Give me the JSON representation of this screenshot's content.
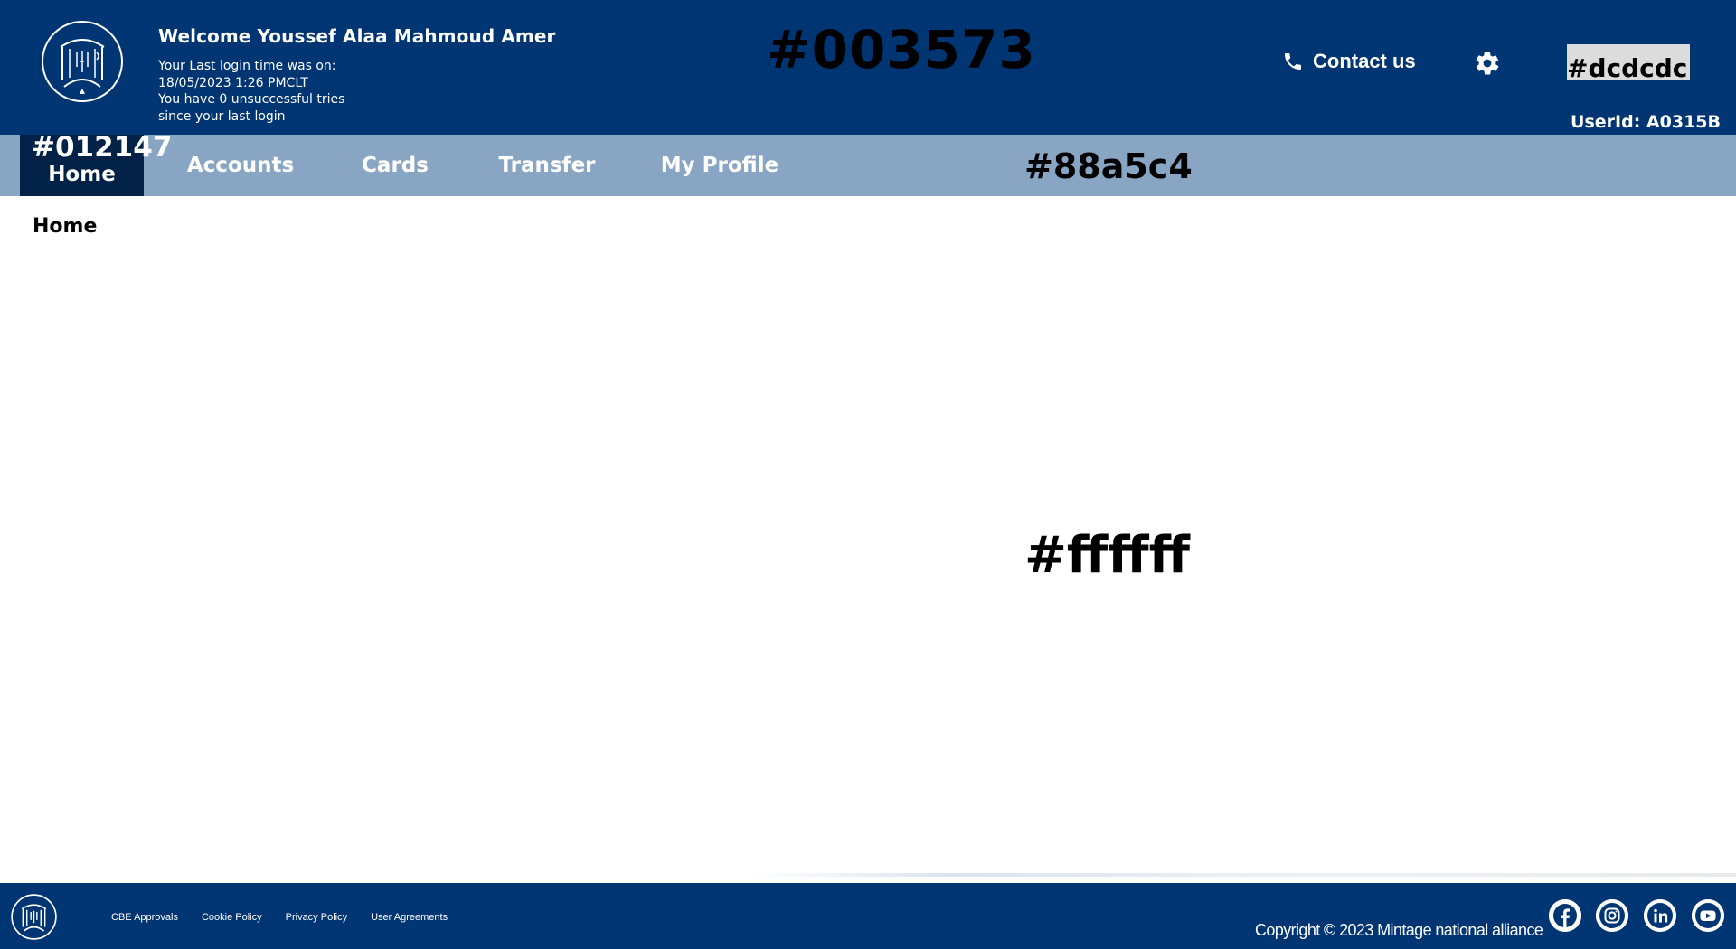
{
  "header": {
    "welcome": "Welcome Youssef Alaa Mahmoud Amer",
    "login_line1": "Your Last login time was on:",
    "login_line2": "18/05/2023 1:26 PMCLT",
    "login_line3": "You have 0 unsuccessful tries",
    "login_line4": "since your last login",
    "color_label": "#003573",
    "contact_label": "Contact us",
    "swatch_label": "#dcdcdc",
    "userid": "UserId: A0315B"
  },
  "nav": {
    "home_color_label": "#012147",
    "items": [
      {
        "label": "Home"
      },
      {
        "label": "Accounts"
      },
      {
        "label": "Cards"
      },
      {
        "label": "Transfer"
      },
      {
        "label": "My Profile"
      }
    ],
    "color_label": "#88a5c4"
  },
  "main": {
    "breadcrumb": "Home",
    "color_label": "#ffffff"
  },
  "footer": {
    "links": [
      {
        "label": "CBE Approvals"
      },
      {
        "label": "Cookie Policy"
      },
      {
        "label": "Privacy Policy"
      },
      {
        "label": "User Agreements"
      }
    ],
    "copyright": "Copyright © 2023 Mintage national alliance",
    "social": [
      "facebook-icon",
      "instagram-icon",
      "linkedin-icon",
      "youtube-icon"
    ]
  },
  "colors": {
    "header_bg": "#003573",
    "nav_bg": "#88a5c4",
    "nav_active_bg": "#012147",
    "swatch_bg": "#dcdcdc",
    "main_bg": "#ffffff"
  }
}
